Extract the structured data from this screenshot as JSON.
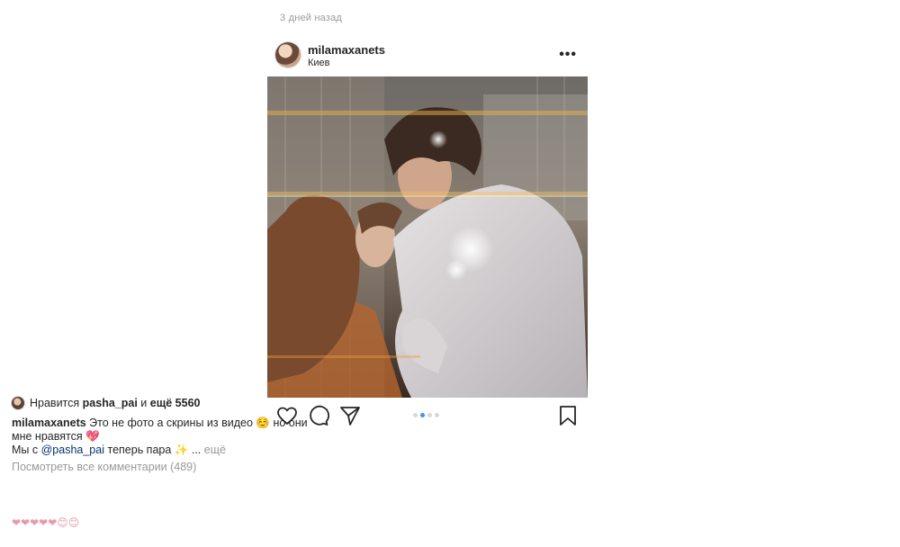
{
  "post": {
    "time_ago": "3 дней назад",
    "author": "milamaxanets",
    "location": "Киев",
    "more_icon": "more-horizontal-icon",
    "carousel": {
      "total": 4,
      "active_index": 1
    },
    "likes": {
      "prefix": "Нравится",
      "user": "pasha_pai",
      "conjunction": "и",
      "rest": "ещё 5560"
    },
    "caption": {
      "author": "milamaxanets",
      "line1": "Это не фото а скрины из видео",
      "emoji1": "☺️",
      "line1_end": "но они",
      "line2": "мне нравятся",
      "emoji2": "💖",
      "line3_start": "Мы с",
      "mention": "@pasha_pai",
      "line3_end": "теперь пара",
      "emoji3": "✨",
      "ellipsis": "...",
      "more_label": "ещё"
    },
    "view_comments": "Посмотреть все комментарии (489)",
    "partial_comment": "❤❤❤❤❤😊😊"
  }
}
